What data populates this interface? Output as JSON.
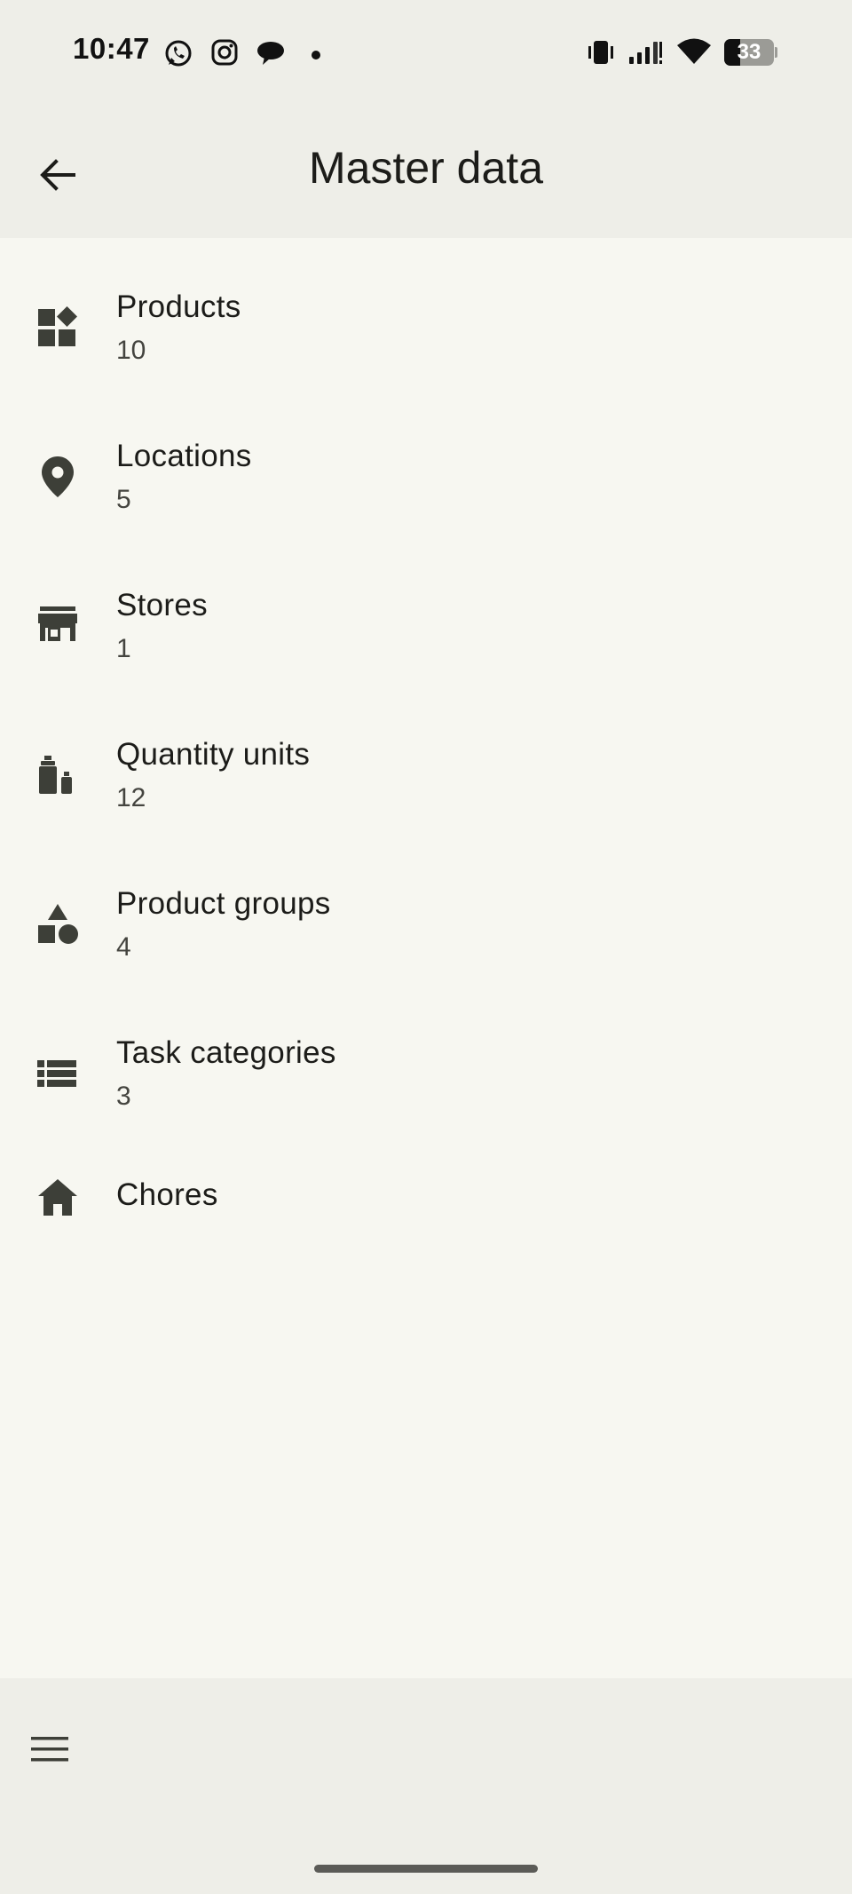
{
  "status_bar": {
    "time": "10:47",
    "notification_icons": [
      "whatsapp-icon",
      "instagram-icon",
      "chat-bubble-icon",
      "more-dot-icon"
    ],
    "system_icons": [
      "vibrate-icon",
      "signal-icon",
      "wifi-icon"
    ],
    "battery_level": 33,
    "battery_text": "33"
  },
  "app_bar": {
    "title": "Master data",
    "back_icon": "arrow-back-icon"
  },
  "items": [
    {
      "label": "Products",
      "count": "10",
      "icon": "widgets-icon"
    },
    {
      "label": "Locations",
      "count": "5",
      "icon": "location-pin-icon"
    },
    {
      "label": "Stores",
      "count": "1",
      "icon": "storefront-icon"
    },
    {
      "label": "Quantity units",
      "count": "12",
      "icon": "scale-bottles-icon"
    },
    {
      "label": "Product groups",
      "count": "4",
      "icon": "category-shapes-icon"
    },
    {
      "label": "Task categories",
      "count": "3",
      "icon": "list-icon"
    },
    {
      "label": "Chores",
      "icon": "home-icon"
    }
  ],
  "bottom_bar": {
    "menu_icon": "hamburger-menu-icon"
  },
  "colors": {
    "background": "#f7f7f1",
    "bar_background": "#eeeee8",
    "icon": "#3d3f38",
    "text": "#1c1c19"
  }
}
